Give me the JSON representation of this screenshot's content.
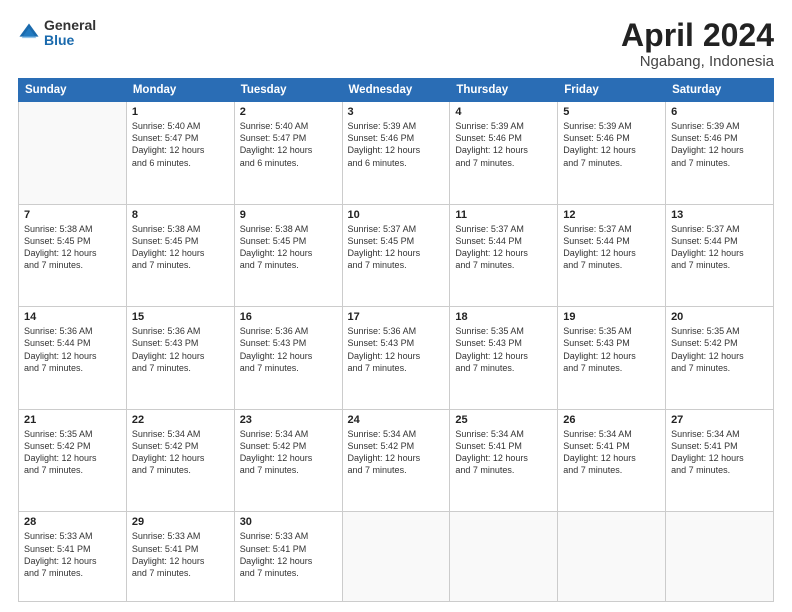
{
  "logo": {
    "general": "General",
    "blue": "Blue"
  },
  "header": {
    "month": "April 2024",
    "location": "Ngabang, Indonesia"
  },
  "weekdays": [
    "Sunday",
    "Monday",
    "Tuesday",
    "Wednesday",
    "Thursday",
    "Friday",
    "Saturday"
  ],
  "weeks": [
    [
      {
        "day": "",
        "sunrise": "",
        "sunset": "",
        "daylight": ""
      },
      {
        "day": "1",
        "sunrise": "5:40 AM",
        "sunset": "5:47 PM",
        "daylight": "12 hours and 6 minutes."
      },
      {
        "day": "2",
        "sunrise": "5:40 AM",
        "sunset": "5:47 PM",
        "daylight": "12 hours and 6 minutes."
      },
      {
        "day": "3",
        "sunrise": "5:39 AM",
        "sunset": "5:46 PM",
        "daylight": "12 hours and 6 minutes."
      },
      {
        "day": "4",
        "sunrise": "5:39 AM",
        "sunset": "5:46 PM",
        "daylight": "12 hours and 7 minutes."
      },
      {
        "day": "5",
        "sunrise": "5:39 AM",
        "sunset": "5:46 PM",
        "daylight": "12 hours and 7 minutes."
      },
      {
        "day": "6",
        "sunrise": "5:39 AM",
        "sunset": "5:46 PM",
        "daylight": "12 hours and 7 minutes."
      }
    ],
    [
      {
        "day": "7",
        "sunrise": "5:38 AM",
        "sunset": "5:45 PM",
        "daylight": "12 hours and 7 minutes."
      },
      {
        "day": "8",
        "sunrise": "5:38 AM",
        "sunset": "5:45 PM",
        "daylight": "12 hours and 7 minutes."
      },
      {
        "day": "9",
        "sunrise": "5:38 AM",
        "sunset": "5:45 PM",
        "daylight": "12 hours and 7 minutes."
      },
      {
        "day": "10",
        "sunrise": "5:37 AM",
        "sunset": "5:45 PM",
        "daylight": "12 hours and 7 minutes."
      },
      {
        "day": "11",
        "sunrise": "5:37 AM",
        "sunset": "5:44 PM",
        "daylight": "12 hours and 7 minutes."
      },
      {
        "day": "12",
        "sunrise": "5:37 AM",
        "sunset": "5:44 PM",
        "daylight": "12 hours and 7 minutes."
      },
      {
        "day": "13",
        "sunrise": "5:37 AM",
        "sunset": "5:44 PM",
        "daylight": "12 hours and 7 minutes."
      }
    ],
    [
      {
        "day": "14",
        "sunrise": "5:36 AM",
        "sunset": "5:44 PM",
        "daylight": "12 hours and 7 minutes."
      },
      {
        "day": "15",
        "sunrise": "5:36 AM",
        "sunset": "5:43 PM",
        "daylight": "12 hours and 7 minutes."
      },
      {
        "day": "16",
        "sunrise": "5:36 AM",
        "sunset": "5:43 PM",
        "daylight": "12 hours and 7 minutes."
      },
      {
        "day": "17",
        "sunrise": "5:36 AM",
        "sunset": "5:43 PM",
        "daylight": "12 hours and 7 minutes."
      },
      {
        "day": "18",
        "sunrise": "5:35 AM",
        "sunset": "5:43 PM",
        "daylight": "12 hours and 7 minutes."
      },
      {
        "day": "19",
        "sunrise": "5:35 AM",
        "sunset": "5:43 PM",
        "daylight": "12 hours and 7 minutes."
      },
      {
        "day": "20",
        "sunrise": "5:35 AM",
        "sunset": "5:42 PM",
        "daylight": "12 hours and 7 minutes."
      }
    ],
    [
      {
        "day": "21",
        "sunrise": "5:35 AM",
        "sunset": "5:42 PM",
        "daylight": "12 hours and 7 minutes."
      },
      {
        "day": "22",
        "sunrise": "5:34 AM",
        "sunset": "5:42 PM",
        "daylight": "12 hours and 7 minutes."
      },
      {
        "day": "23",
        "sunrise": "5:34 AM",
        "sunset": "5:42 PM",
        "daylight": "12 hours and 7 minutes."
      },
      {
        "day": "24",
        "sunrise": "5:34 AM",
        "sunset": "5:42 PM",
        "daylight": "12 hours and 7 minutes."
      },
      {
        "day": "25",
        "sunrise": "5:34 AM",
        "sunset": "5:41 PM",
        "daylight": "12 hours and 7 minutes."
      },
      {
        "day": "26",
        "sunrise": "5:34 AM",
        "sunset": "5:41 PM",
        "daylight": "12 hours and 7 minutes."
      },
      {
        "day": "27",
        "sunrise": "5:34 AM",
        "sunset": "5:41 PM",
        "daylight": "12 hours and 7 minutes."
      }
    ],
    [
      {
        "day": "28",
        "sunrise": "5:33 AM",
        "sunset": "5:41 PM",
        "daylight": "12 hours and 7 minutes."
      },
      {
        "day": "29",
        "sunrise": "5:33 AM",
        "sunset": "5:41 PM",
        "daylight": "12 hours and 7 minutes."
      },
      {
        "day": "30",
        "sunrise": "5:33 AM",
        "sunset": "5:41 PM",
        "daylight": "12 hours and 7 minutes."
      },
      {
        "day": "",
        "sunrise": "",
        "sunset": "",
        "daylight": ""
      },
      {
        "day": "",
        "sunrise": "",
        "sunset": "",
        "daylight": ""
      },
      {
        "day": "",
        "sunrise": "",
        "sunset": "",
        "daylight": ""
      },
      {
        "day": "",
        "sunrise": "",
        "sunset": "",
        "daylight": ""
      }
    ]
  ]
}
